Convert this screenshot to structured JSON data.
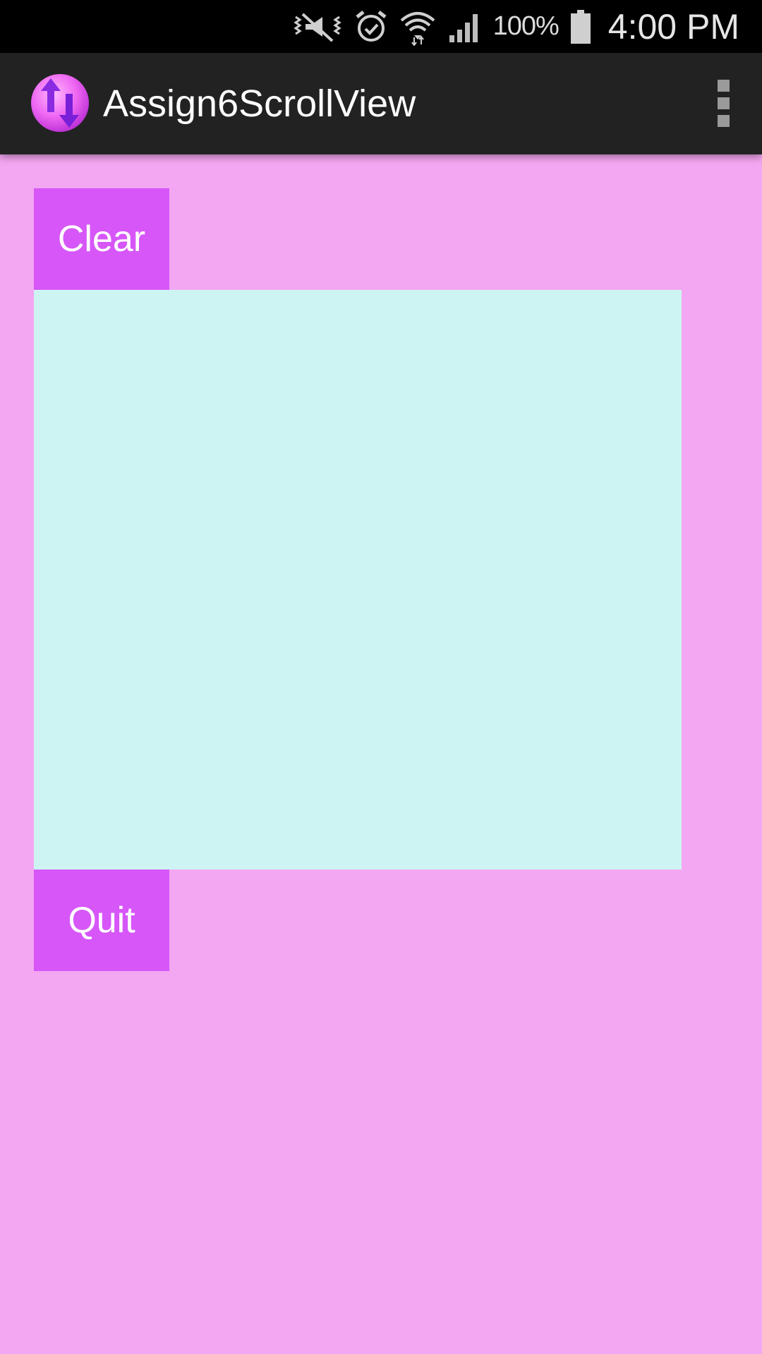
{
  "status_bar": {
    "icons": [
      "vibrate-mute-icon",
      "alarm-icon",
      "wifi-icon",
      "signal-icon",
      "battery-icon"
    ],
    "battery_percent": "100%",
    "time": "4:00 PM"
  },
  "action_bar": {
    "app_icon": "up-down-arrows-icon",
    "title": "Assign6ScrollView",
    "overflow_icon": "overflow-menu-icon"
  },
  "main": {
    "clear_label": "Clear",
    "quit_label": "Quit"
  },
  "colors": {
    "background": "#f3a6f1",
    "button": "#d656f8",
    "canvas": "#cdf4f3",
    "action_bar": "#222222",
    "status_bar": "#000000"
  }
}
